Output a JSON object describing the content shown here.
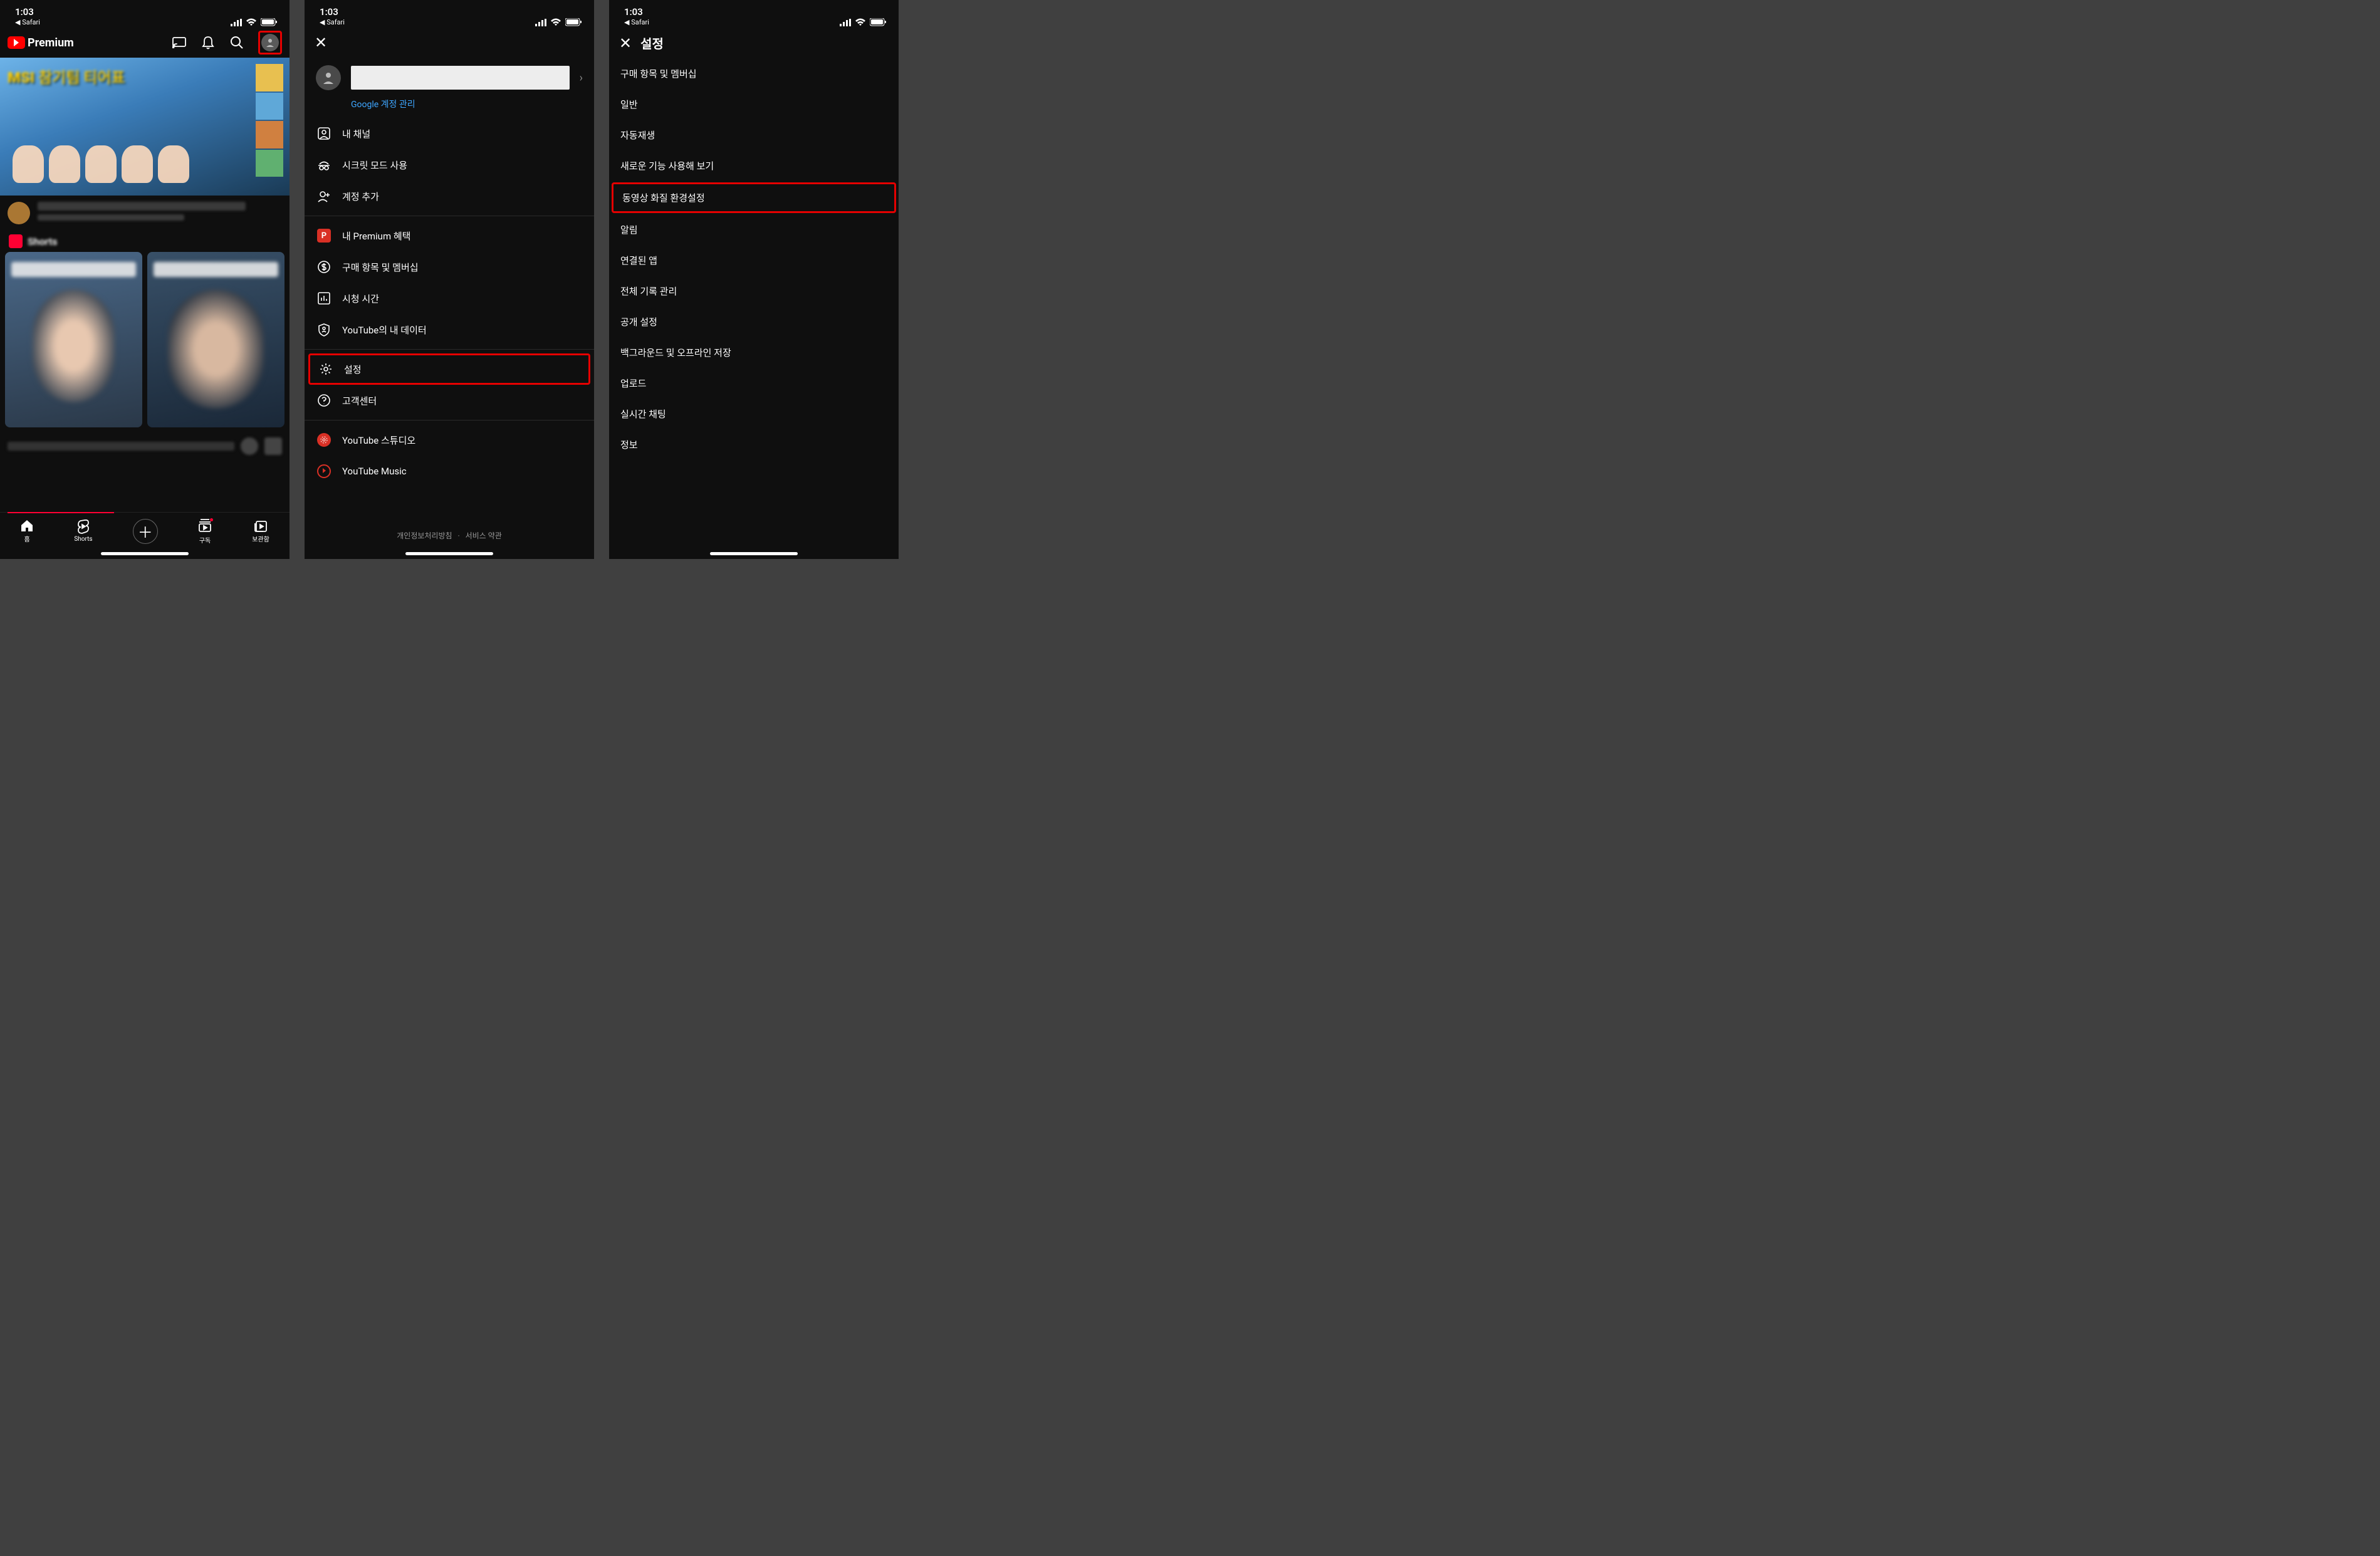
{
  "status": {
    "time": "1:03",
    "back_app": "◀ Safari"
  },
  "screen1": {
    "logo_text": "Premium",
    "shorts_label": "Shorts",
    "nav": {
      "home": "홈",
      "shorts": "Shorts",
      "subs": "구독",
      "library": "보관함"
    }
  },
  "screen2": {
    "google_link": "Google 계정 관리",
    "items_a": [
      {
        "icon": "user",
        "label": "내 채널"
      },
      {
        "icon": "incognito",
        "label": "시크릿 모드 사용"
      },
      {
        "icon": "adduser",
        "label": "계정 추가"
      }
    ],
    "items_b": [
      {
        "icon": "P",
        "label": "내 Premium 혜택"
      },
      {
        "icon": "dollar",
        "label": "구매 항목 및 멤버십"
      },
      {
        "icon": "chart",
        "label": "시청 시간"
      },
      {
        "icon": "shield",
        "label": "YouTube의 내 데이터"
      }
    ],
    "items_c": [
      {
        "icon": "gear",
        "label": "설정",
        "hl": true
      },
      {
        "icon": "help",
        "label": "고객센터"
      }
    ],
    "items_d": [
      {
        "icon": "studio",
        "label": "YouTube 스튜디오"
      },
      {
        "icon": "music",
        "label": "YouTube Music"
      }
    ],
    "footer": {
      "privacy": "개인정보처리방침",
      "sep": "·",
      "tos": "서비스 약관"
    }
  },
  "screen3": {
    "title": "설정",
    "items": [
      {
        "label": "구매 항목 및 멤버십"
      },
      {
        "label": "일반"
      },
      {
        "label": "자동재생"
      },
      {
        "label": "새로운 기능 사용해 보기"
      },
      {
        "label": "동영상 화질 환경설정",
        "hl": true
      },
      {
        "label": "알림"
      },
      {
        "label": "연결된 앱"
      },
      {
        "label": "전체 기록 관리"
      },
      {
        "label": "공개 설정"
      },
      {
        "label": "백그라운드 및 오프라인 저장"
      },
      {
        "label": "업로드"
      },
      {
        "label": "실시간 채팅"
      },
      {
        "label": "정보"
      }
    ]
  }
}
